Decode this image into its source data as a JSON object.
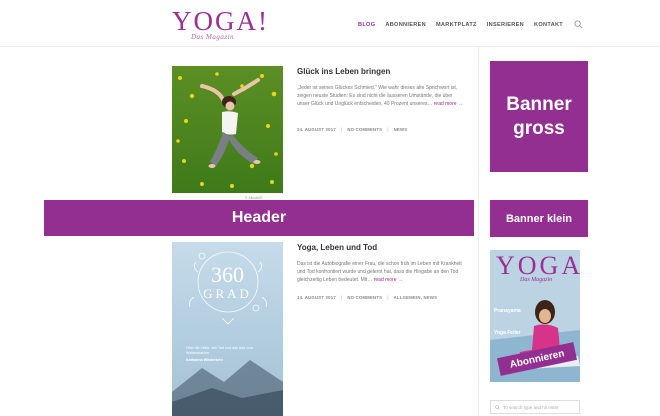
{
  "site": {
    "logo_text": "YOGA!",
    "logo_tagline": "Das Magazin"
  },
  "nav": {
    "items": [
      "BLOG",
      "ABONNIEREN",
      "MARKTPLATZ",
      "INSERIEREN",
      "KONTAKT"
    ],
    "active": "BLOG",
    "search_icon": "search-icon"
  },
  "posts": [
    {
      "title": "Glück ins Leben bringen",
      "excerpt": "„Jeder ist seines Glückes Schmied.\" Wie wahr dieses alte Sprichwort ist, zeigen neuste Studien: Es sind nicht die äusseren Umstände, die über unser Glück und Unglück entscheiden, 40 Prozent unseres…",
      "read_more": "read more →",
      "date": "24. AUGUST 2017",
      "comments": "NO COMMENTS",
      "categories": "NEWS",
      "image_credit": "© Alinute/S"
    },
    {
      "title": "Yoga, Leben und Tod",
      "excerpt": "Das ist die Autobiografie einer Frau, die schon früh im Leben mit Krankheit und Tod konfrontiert wurde und gelernt hat, dass die Hingabe an den Tod gleichzeitig Leben bedeutet. Mit…",
      "read_more": "read more →",
      "date": "14. AUGUST 2017",
      "comments": "NO COMMENTS",
      "categories": "ALLGEMEIN, NEWS",
      "book": {
        "title_number": "360",
        "title_word": "GRAD",
        "subtitle": "Über die Liebe, den Tod und das was zum Weiterstrahlen",
        "author": "Katharina Wiederkehr"
      }
    }
  ],
  "placeholders": {
    "header": "Header",
    "banner_gross": "Banner gross",
    "banner_klein": "Banner klein"
  },
  "magazine": {
    "logo_text": "YOGA",
    "logo_tagline": "Das Magazin",
    "cta": "Abonnieren",
    "teaser_1": "Pranayama",
    "teaser_2": "Yoga Feiler"
  },
  "sidebar_search": {
    "placeholder": "To search type and hit enter"
  },
  "colors": {
    "accent": "#932f91"
  }
}
